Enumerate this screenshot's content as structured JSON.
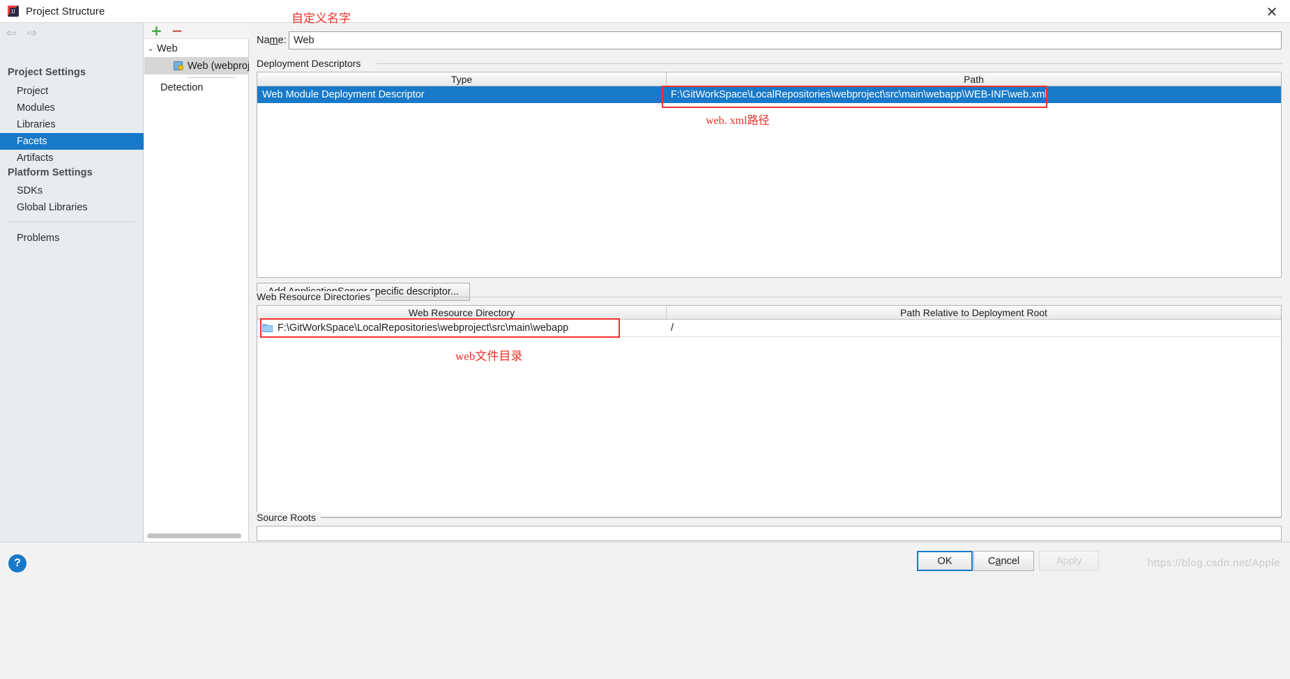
{
  "window": {
    "title": "Project Structure",
    "app_icon": "intellij-idea-icon",
    "close_label": "✕"
  },
  "sidebar": {
    "back_icon": "arrow-left-icon",
    "forward_icon": "arrow-right-icon",
    "groups": [
      {
        "heading": "Project Settings",
        "items": [
          "Project",
          "Modules",
          "Libraries",
          "Facets",
          "Artifacts"
        ]
      },
      {
        "heading": "Platform Settings",
        "items": [
          "SDKs",
          "Global Libraries"
        ]
      }
    ],
    "selected": "Facets",
    "footer_items": [
      "Problems"
    ]
  },
  "tree": {
    "toolbar": {
      "add": "+",
      "remove": "−"
    },
    "root": {
      "label": "Web",
      "chevron": "⌄"
    },
    "child": {
      "label": "Web (webproj",
      "icon": "web-facet-icon",
      "selected": true
    },
    "detection": "Detection"
  },
  "form": {
    "name_label_pre": "Na",
    "name_label_accel": "m",
    "name_label_post": "e:",
    "name_value": "Web",
    "name_placeholder": ""
  },
  "deployment": {
    "section_title": "Deployment Descriptors",
    "columns": [
      "Type",
      "Path"
    ],
    "rows": [
      {
        "type": "Web Module Deployment Descriptor",
        "path": "F:\\GitWorkSpace\\LocalRepositories\\webproject\\src\\main\\webapp\\WEB-INF\\web.xml",
        "selected": true
      }
    ],
    "add_button": {
      "pre": "Add Application ",
      "accel": "S",
      "post": "erver specific descriptor..."
    },
    "toolbar": {
      "add_icon": "plus-icon",
      "remove_icon": "minus-icon",
      "edit_icon": "pencil-icon"
    }
  },
  "web_resources": {
    "section_title": "Web Resource Directories",
    "columns": [
      "Web Resource Directory",
      "Path Relative to Deployment Root"
    ],
    "rows": [
      {
        "directory": "F:\\GitWorkSpace\\LocalRepositories\\webproject\\src\\main\\webapp",
        "relative_path": "/",
        "icon": "folder-icon"
      }
    ],
    "toolbar": {
      "add_icon": "plus-icon",
      "remove_icon": "minus-icon",
      "edit_icon": "pencil-icon",
      "help_icon": "question-mark-icon"
    }
  },
  "source_roots": {
    "section_title": "Source Roots"
  },
  "annotations": [
    {
      "text": "自定义名字"
    },
    {
      "text": "web. xml路径"
    },
    {
      "text": "web文件目录"
    }
  ],
  "footer": {
    "help_icon": "question-mark-icon",
    "ok_pre": "O",
    "ok_accel": "",
    "ok_label": "OK",
    "cancel_pre": "C",
    "cancel_accel": "a",
    "cancel_post": "ncel",
    "apply_label": "Apply",
    "watermark": "https://blog.csdn.net/Apple"
  },
  "colors": {
    "accent": "#1879c8",
    "annotation": "#e8312a",
    "annotation_box": "#f23030",
    "add_green": "#3fa63f",
    "remove_red": "#c55a58"
  }
}
